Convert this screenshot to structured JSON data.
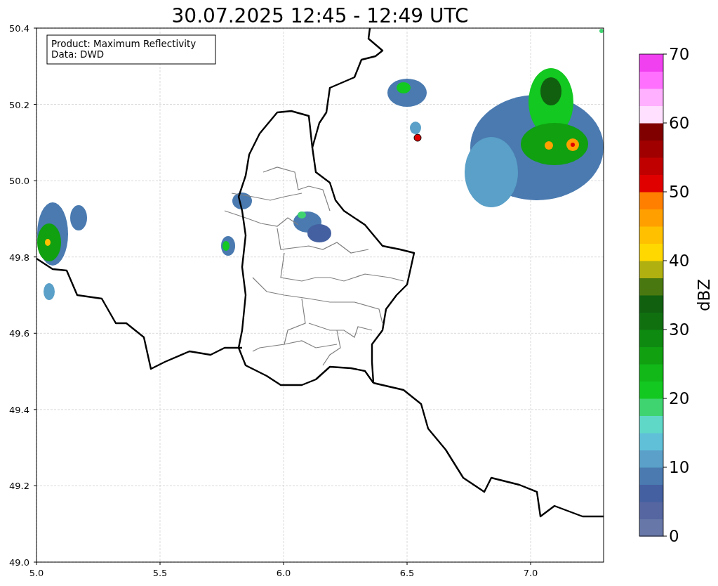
{
  "title": "30.07.2025 12:45 - 12:49 UTC",
  "map": {
    "xticks": [
      "5.0",
      "5.5",
      "6.0",
      "6.5",
      "7.0"
    ],
    "yticks": [
      "50.4",
      "50.2",
      "50.0",
      "49.8",
      "49.6",
      "49.4",
      "49.2",
      "49.0"
    ],
    "annotation": [
      "Product: Maximum Reflectivity",
      "Data: DWD"
    ]
  },
  "colorbar": {
    "label": "dBZ",
    "ticks": [
      "70",
      "60",
      "50",
      "40",
      "30",
      "20",
      "10",
      "0"
    ],
    "levels": [
      {
        "color": "#6677a8"
      },
      {
        "color": "#5566a0"
      },
      {
        "color": "#4460a0"
      },
      {
        "color": "#4a7ab0"
      },
      {
        "color": "#5aa0c8"
      },
      {
        "color": "#60c0d8"
      },
      {
        "color": "#60d8c8"
      },
      {
        "color": "#3fd470"
      },
      {
        "color": "#13c820"
      },
      {
        "color": "#12b818"
      },
      {
        "color": "#10a010"
      },
      {
        "color": "#0e8a10"
      },
      {
        "color": "#107010"
      },
      {
        "color": "#106010"
      },
      {
        "color": "#4a7810"
      },
      {
        "color": "#b0b010"
      },
      {
        "color": "#ffd800"
      },
      {
        "color": "#ffc000"
      },
      {
        "color": "#ffa000"
      },
      {
        "color": "#ff8000"
      },
      {
        "color": "#e00000"
      },
      {
        "color": "#c00000"
      },
      {
        "color": "#a00000"
      },
      {
        "color": "#800000"
      },
      {
        "color": "#ffe0ff"
      },
      {
        "color": "#ffb0ff"
      },
      {
        "color": "#ff70ff"
      },
      {
        "color": "#f040f0"
      }
    ]
  }
}
